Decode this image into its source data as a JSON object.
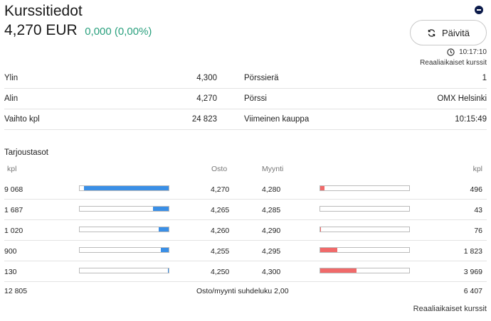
{
  "header": {
    "title": "Kurssitiedot",
    "price": "4,270 EUR",
    "change": "0,000 (0,00%)",
    "refresh_label": "Päivitä",
    "time": "10:17:10",
    "realtime_label": "Reaaliaikaiset kurssit"
  },
  "info": [
    {
      "label": "Ylin",
      "value": "4,300",
      "label2": "Pörssierä",
      "value2": "1"
    },
    {
      "label": "Alin",
      "value": "4,270",
      "label2": "Pörssi",
      "value2": "OMX Helsinki"
    },
    {
      "label": "Vaihto kpl",
      "value": "24 823",
      "label2": "Viimeinen kauppa",
      "value2": "10:15:49"
    }
  ],
  "orderbook": {
    "title": "Tarjoustasot",
    "headers": {
      "buy_qty": "kpl",
      "buy_price": "Osto",
      "sell_price": "Myynti",
      "sell_qty": "kpl"
    },
    "rows": [
      {
        "buy_qty": "9 068",
        "buy_fill": 0.95,
        "buy_price": "4,270",
        "sell_price": "4,280",
        "sell_fill": 0.05,
        "sell_qty": "496"
      },
      {
        "buy_qty": "1 687",
        "buy_fill": 0.18,
        "buy_price": "4,265",
        "sell_price": "4,285",
        "sell_fill": 0.0,
        "sell_qty": "43"
      },
      {
        "buy_qty": "1 020",
        "buy_fill": 0.11,
        "buy_price": "4,260",
        "sell_price": "4,290",
        "sell_fill": 0.01,
        "sell_qty": "76"
      },
      {
        "buy_qty": "900",
        "buy_fill": 0.09,
        "buy_price": "4,255",
        "sell_price": "4,295",
        "sell_fill": 0.19,
        "sell_qty": "1 823"
      },
      {
        "buy_qty": "130",
        "buy_fill": 0.01,
        "buy_price": "4,250",
        "sell_price": "4,300",
        "sell_fill": 0.41,
        "sell_qty": "3 969"
      }
    ],
    "footer": {
      "buy_total": "12 805",
      "ratio": "Osto/myynti suhdeluku 2,00",
      "sell_total": "6 407"
    }
  },
  "footer_realtime": "Reaaliaikaiset kurssit"
}
